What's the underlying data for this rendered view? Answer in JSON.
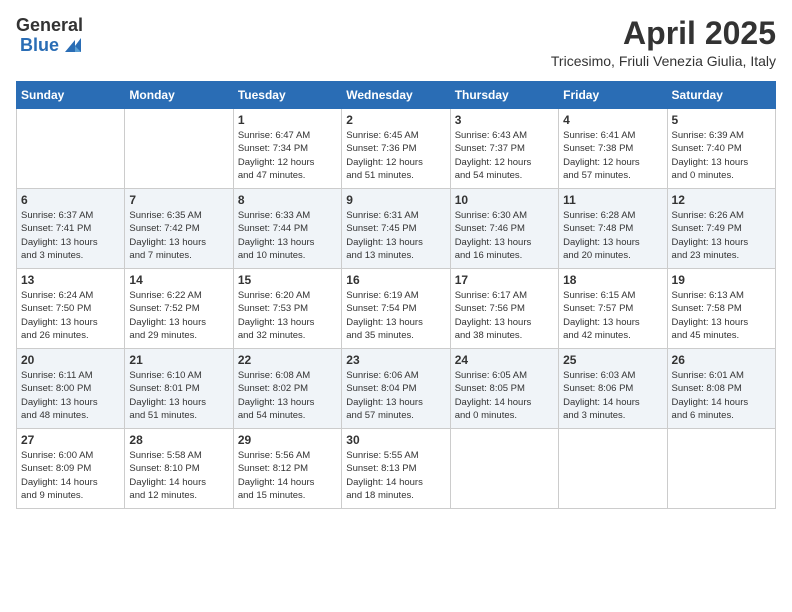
{
  "logo": {
    "general": "General",
    "blue": "Blue"
  },
  "title": "April 2025",
  "subtitle": "Tricesimo, Friuli Venezia Giulia, Italy",
  "header": {
    "days": [
      "Sunday",
      "Monday",
      "Tuesday",
      "Wednesday",
      "Thursday",
      "Friday",
      "Saturday"
    ]
  },
  "weeks": [
    [
      {
        "day": "",
        "info": ""
      },
      {
        "day": "",
        "info": ""
      },
      {
        "day": "1",
        "info": "Sunrise: 6:47 AM\nSunset: 7:34 PM\nDaylight: 12 hours\nand 47 minutes."
      },
      {
        "day": "2",
        "info": "Sunrise: 6:45 AM\nSunset: 7:36 PM\nDaylight: 12 hours\nand 51 minutes."
      },
      {
        "day": "3",
        "info": "Sunrise: 6:43 AM\nSunset: 7:37 PM\nDaylight: 12 hours\nand 54 minutes."
      },
      {
        "day": "4",
        "info": "Sunrise: 6:41 AM\nSunset: 7:38 PM\nDaylight: 12 hours\nand 57 minutes."
      },
      {
        "day": "5",
        "info": "Sunrise: 6:39 AM\nSunset: 7:40 PM\nDaylight: 13 hours\nand 0 minutes."
      }
    ],
    [
      {
        "day": "6",
        "info": "Sunrise: 6:37 AM\nSunset: 7:41 PM\nDaylight: 13 hours\nand 3 minutes."
      },
      {
        "day": "7",
        "info": "Sunrise: 6:35 AM\nSunset: 7:42 PM\nDaylight: 13 hours\nand 7 minutes."
      },
      {
        "day": "8",
        "info": "Sunrise: 6:33 AM\nSunset: 7:44 PM\nDaylight: 13 hours\nand 10 minutes."
      },
      {
        "day": "9",
        "info": "Sunrise: 6:31 AM\nSunset: 7:45 PM\nDaylight: 13 hours\nand 13 minutes."
      },
      {
        "day": "10",
        "info": "Sunrise: 6:30 AM\nSunset: 7:46 PM\nDaylight: 13 hours\nand 16 minutes."
      },
      {
        "day": "11",
        "info": "Sunrise: 6:28 AM\nSunset: 7:48 PM\nDaylight: 13 hours\nand 20 minutes."
      },
      {
        "day": "12",
        "info": "Sunrise: 6:26 AM\nSunset: 7:49 PM\nDaylight: 13 hours\nand 23 minutes."
      }
    ],
    [
      {
        "day": "13",
        "info": "Sunrise: 6:24 AM\nSunset: 7:50 PM\nDaylight: 13 hours\nand 26 minutes."
      },
      {
        "day": "14",
        "info": "Sunrise: 6:22 AM\nSunset: 7:52 PM\nDaylight: 13 hours\nand 29 minutes."
      },
      {
        "day": "15",
        "info": "Sunrise: 6:20 AM\nSunset: 7:53 PM\nDaylight: 13 hours\nand 32 minutes."
      },
      {
        "day": "16",
        "info": "Sunrise: 6:19 AM\nSunset: 7:54 PM\nDaylight: 13 hours\nand 35 minutes."
      },
      {
        "day": "17",
        "info": "Sunrise: 6:17 AM\nSunset: 7:56 PM\nDaylight: 13 hours\nand 38 minutes."
      },
      {
        "day": "18",
        "info": "Sunrise: 6:15 AM\nSunset: 7:57 PM\nDaylight: 13 hours\nand 42 minutes."
      },
      {
        "day": "19",
        "info": "Sunrise: 6:13 AM\nSunset: 7:58 PM\nDaylight: 13 hours\nand 45 minutes."
      }
    ],
    [
      {
        "day": "20",
        "info": "Sunrise: 6:11 AM\nSunset: 8:00 PM\nDaylight: 13 hours\nand 48 minutes."
      },
      {
        "day": "21",
        "info": "Sunrise: 6:10 AM\nSunset: 8:01 PM\nDaylight: 13 hours\nand 51 minutes."
      },
      {
        "day": "22",
        "info": "Sunrise: 6:08 AM\nSunset: 8:02 PM\nDaylight: 13 hours\nand 54 minutes."
      },
      {
        "day": "23",
        "info": "Sunrise: 6:06 AM\nSunset: 8:04 PM\nDaylight: 13 hours\nand 57 minutes."
      },
      {
        "day": "24",
        "info": "Sunrise: 6:05 AM\nSunset: 8:05 PM\nDaylight: 14 hours\nand 0 minutes."
      },
      {
        "day": "25",
        "info": "Sunrise: 6:03 AM\nSunset: 8:06 PM\nDaylight: 14 hours\nand 3 minutes."
      },
      {
        "day": "26",
        "info": "Sunrise: 6:01 AM\nSunset: 8:08 PM\nDaylight: 14 hours\nand 6 minutes."
      }
    ],
    [
      {
        "day": "27",
        "info": "Sunrise: 6:00 AM\nSunset: 8:09 PM\nDaylight: 14 hours\nand 9 minutes."
      },
      {
        "day": "28",
        "info": "Sunrise: 5:58 AM\nSunset: 8:10 PM\nDaylight: 14 hours\nand 12 minutes."
      },
      {
        "day": "29",
        "info": "Sunrise: 5:56 AM\nSunset: 8:12 PM\nDaylight: 14 hours\nand 15 minutes."
      },
      {
        "day": "30",
        "info": "Sunrise: 5:55 AM\nSunset: 8:13 PM\nDaylight: 14 hours\nand 18 minutes."
      },
      {
        "day": "",
        "info": ""
      },
      {
        "day": "",
        "info": ""
      },
      {
        "day": "",
        "info": ""
      }
    ]
  ]
}
